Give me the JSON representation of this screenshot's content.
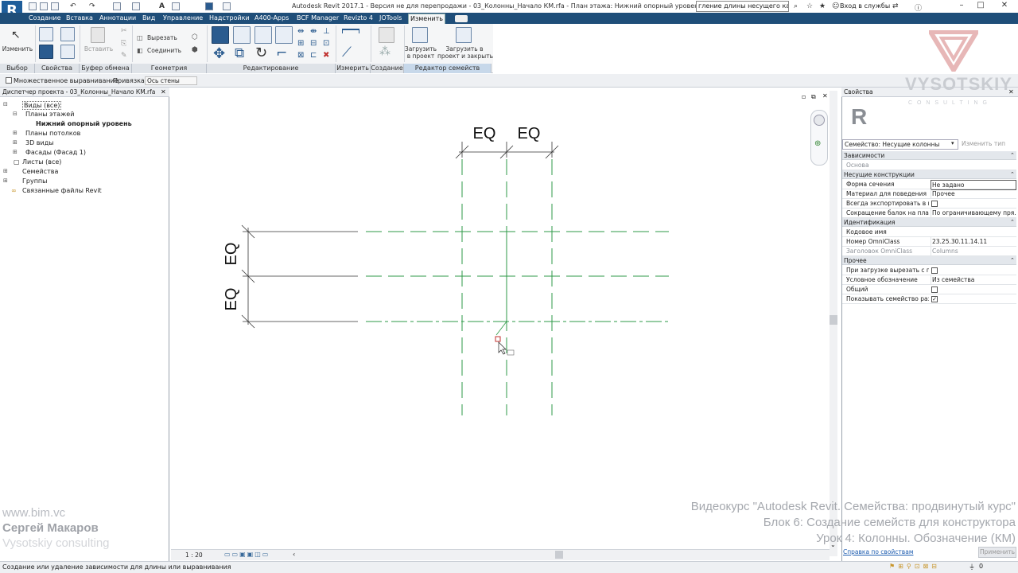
{
  "window": {
    "title": "Autodesk Revit 2017.1 - Версия не для перепродажи -    03_Колонны_Начало КМ.rfa - План этажа: Нижний опорный уровень",
    "search_value": "гление длины несущего каркаса",
    "login_label": "Вход в службы",
    "app_letter": "R"
  },
  "tabs": [
    "Создание",
    "Вставка",
    "Аннотации",
    "Вид",
    "Управление",
    "Надстройки",
    "A400-Apps",
    "BCF Manager",
    "Revizto 4",
    "JOTools",
    "Изменить"
  ],
  "ribbon": {
    "modify_label": "Изменить",
    "paste_label": "Вставить",
    "cut_label": "Вырезать",
    "join_label": "Соединить",
    "load_label_1": "Загрузить",
    "load_label_2": "в проект",
    "load_close_label_1": "Загрузить в",
    "load_close_label_2": "проект и закрыть",
    "panels": {
      "select": "Выбор",
      "properties": "Свойства",
      "clipboard": "Буфер обмена",
      "geometry": "Геометрия",
      "modify": "Редактирование",
      "measure": "Измерить",
      "create": "Создание",
      "family_editor": "Редактор семейств"
    }
  },
  "options_bar": {
    "multiple_alignment": "Множественное выравнивание",
    "snap_label": "Привязка:",
    "snap_value": "Ось стены"
  },
  "browser": {
    "title": "Диспетчер проекта - 03_Колонны_Начало КМ.rfa",
    "items": [
      {
        "label": "Виды (все)"
      },
      {
        "label": "Планы этажей"
      },
      {
        "label": "Нижний опорный уровень"
      },
      {
        "label": "Планы потолков"
      },
      {
        "label": "3D виды"
      },
      {
        "label": "Фасады (Фасад 1)"
      },
      {
        "label": "Листы (все)"
      },
      {
        "label": "Семейства"
      },
      {
        "label": "Группы"
      },
      {
        "label": "Связанные файлы Revit"
      }
    ]
  },
  "canvas": {
    "eq_labels": [
      "EQ",
      "EQ",
      "EQ",
      "EQ"
    ],
    "scale": "1 : 20"
  },
  "properties": {
    "title": "Свойства",
    "type_selector": "Семейство: Несущие колонны",
    "edit_type": "Изменить тип",
    "groups": [
      {
        "name": "Зависимости",
        "rows": [
          {
            "name": "Основа",
            "value": "",
            "disabled": true
          }
        ]
      },
      {
        "name": "Несущие конструкции",
        "rows": [
          {
            "name": "Форма сечения",
            "value": "Не задано"
          },
          {
            "name": "Материал для поведения ...",
            "value": "Прочее"
          },
          {
            "name": "Всегда экспортировать в в...",
            "value": "",
            "checkbox": false
          },
          {
            "name": "Сокращение балок на пла...",
            "value": "По ограничивающему пря..."
          }
        ]
      },
      {
        "name": "Идентификация",
        "rows": [
          {
            "name": "Кодовое имя",
            "value": ""
          },
          {
            "name": "Номер OmniClass",
            "value": "23.25.30.11.14.11"
          },
          {
            "name": "Заголовок OmniClass",
            "value": "Columns",
            "disabled": true
          }
        ]
      },
      {
        "name": "Прочее",
        "rows": [
          {
            "name": "При загрузке вырезать с п...",
            "value": "",
            "checkbox": false
          },
          {
            "name": "Условное обозначение",
            "value": "Из семейства"
          },
          {
            "name": "Общий",
            "value": "",
            "checkbox": false
          },
          {
            "name": "Показывать семейство раз...",
            "value": "",
            "checkbox": true
          }
        ]
      }
    ],
    "help_link": "Справка по свойствам",
    "apply_button": "Применить"
  },
  "status": {
    "text": "Создание или удаление зависимости для длины или выравнивания",
    "counter": "0"
  },
  "watermark": {
    "site": "www.bim.vc",
    "author": "Сергей Макаров",
    "company": "Vysotskiy consulting",
    "logo_text": "VYSOTSKIY",
    "logo_sub": "C O N S U L T I N G",
    "course_line_1": "Видеокурс \"Autodesk Revit. Семейства: продвинутый курс\"",
    "course_line_2": "Блок 6: Создание семейств для конструктора",
    "course_line_3": "Урок 4: Колонны. Обозначение (КМ)"
  },
  "colors": {
    "tab_bar": "#1f4e79",
    "reference_plane": "#2e9a47",
    "brand_logo": "#1e5d9a"
  }
}
